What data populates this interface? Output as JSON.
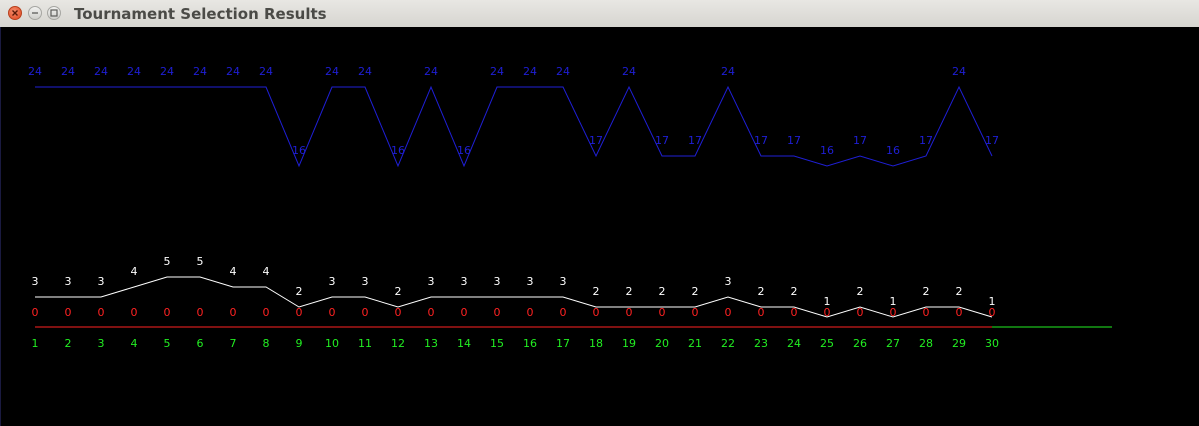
{
  "window": {
    "title": "Tournament Selection Results"
  },
  "chart_data": {
    "type": "line",
    "x": [
      1,
      2,
      3,
      4,
      5,
      6,
      7,
      8,
      9,
      10,
      11,
      12,
      13,
      14,
      15,
      16,
      17,
      18,
      19,
      20,
      21,
      22,
      23,
      24,
      25,
      26,
      27,
      28,
      29,
      30
    ],
    "x_tick_labels": [
      "1",
      "2",
      "3",
      "4",
      "5",
      "6",
      "7",
      "8",
      "9",
      "10",
      "11",
      "12",
      "13",
      "14",
      "15",
      "16",
      "17",
      "18",
      "19",
      "20",
      "21",
      "22",
      "23",
      "24",
      "25",
      "26",
      "27",
      "28",
      "29",
      "30"
    ],
    "series": [
      {
        "values": [
          24,
          24,
          24,
          24,
          24,
          24,
          24,
          24,
          16,
          24,
          24,
          16,
          24,
          16,
          24,
          24,
          24,
          17,
          24,
          17,
          17,
          24,
          17,
          17,
          16,
          17,
          16,
          17,
          24,
          17
        ],
        "color": "#1f1fd6"
      },
      {
        "values": [
          3,
          3,
          3,
          4,
          5,
          5,
          4,
          4,
          2,
          3,
          3,
          2,
          3,
          3,
          3,
          3,
          3,
          2,
          2,
          2,
          2,
          3,
          2,
          2,
          1,
          2,
          1,
          2,
          2,
          1
        ],
        "color": "#ffffff"
      },
      {
        "values": [
          0,
          0,
          0,
          0,
          0,
          0,
          0,
          0,
          0,
          0,
          0,
          0,
          0,
          0,
          0,
          0,
          0,
          0,
          0,
          0,
          0,
          0,
          0,
          0,
          0,
          0,
          0,
          0,
          0,
          0
        ],
        "color": "#ff2222"
      }
    ],
    "axis_color": "#22ee22",
    "grid": false,
    "legend": "none"
  }
}
